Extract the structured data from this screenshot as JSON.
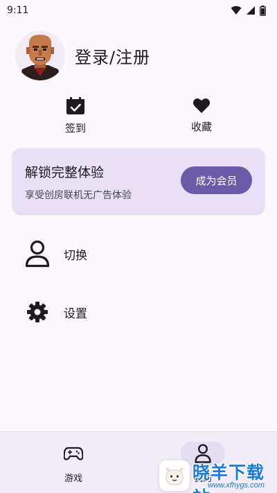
{
  "status_bar": {
    "time": "9:11"
  },
  "profile": {
    "login_label": "登录/注册"
  },
  "quick_actions": {
    "checkin_label": "签到",
    "favorites_label": "收藏"
  },
  "vip_card": {
    "title": "解锁完整体验",
    "subtitle": "享受创房联机无广告体验",
    "button_label": "成为会员",
    "accent_color": "#6b5aa8"
  },
  "menu": {
    "items": [
      {
        "label": "切换",
        "icon": "person-icon"
      },
      {
        "label": "设置",
        "icon": "gear-icon"
      }
    ]
  },
  "bottom_nav": {
    "tabs": [
      {
        "label": "游戏",
        "icon": "gamepad-icon",
        "selected": false
      },
      {
        "label": "我的",
        "icon": "person-icon",
        "selected": true
      }
    ]
  },
  "watermark": {
    "text": "晓羊下载站",
    "url": "www.xfhygs.com"
  }
}
